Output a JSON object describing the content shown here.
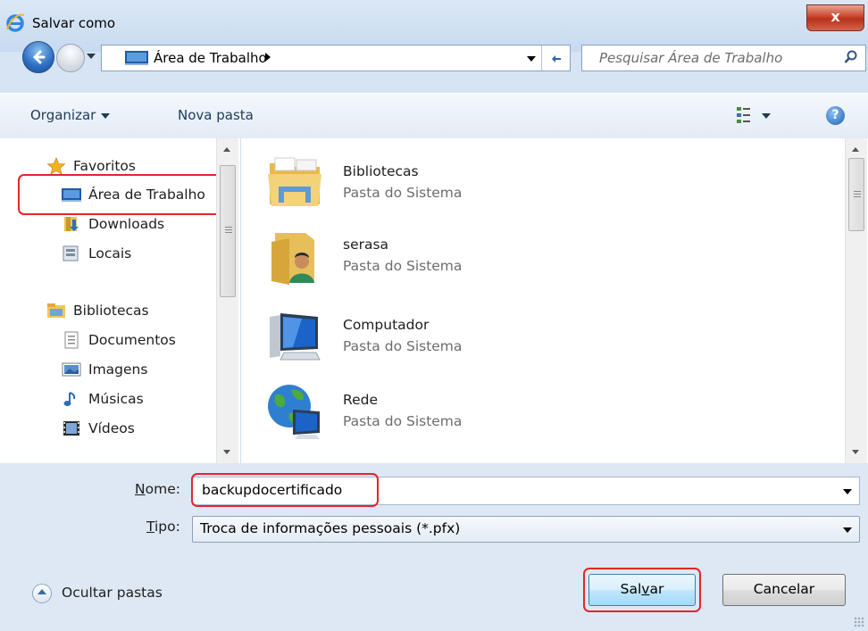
{
  "window": {
    "title": "Salvar como",
    "close_label": "x"
  },
  "address": {
    "location": "Área de Trabalho",
    "search_placeholder": "Pesquisar Área de Trabalho"
  },
  "toolbar": {
    "organize_label": "Organizar",
    "new_folder_label": "Nova pasta",
    "help_label": "?"
  },
  "navigation": {
    "favorites_header": "Favoritos",
    "favorites": [
      {
        "label": "Área de Trabalho",
        "icon": "desktop-icon"
      },
      {
        "label": "Downloads",
        "icon": "downloads-icon"
      },
      {
        "label": "Locais",
        "icon": "recent-places-icon"
      }
    ],
    "libraries_header": "Bibliotecas",
    "libraries": [
      {
        "label": "Documentos",
        "icon": "documents-icon"
      },
      {
        "label": "Imagens",
        "icon": "pictures-icon"
      },
      {
        "label": "Músicas",
        "icon": "music-icon"
      },
      {
        "label": "Vídeos",
        "icon": "videos-icon"
      }
    ],
    "selected": "Área de Trabalho"
  },
  "files": [
    {
      "name": "Bibliotecas",
      "type": "Pasta do Sistema",
      "icon": "libraries-folder-icon"
    },
    {
      "name": "serasa",
      "type": "Pasta do Sistema",
      "icon": "user-folder-icon"
    },
    {
      "name": "Computador",
      "type": "Pasta do Sistema",
      "icon": "computer-icon"
    },
    {
      "name": "Rede",
      "type": "Pasta do Sistema",
      "icon": "network-icon"
    }
  ],
  "form": {
    "name_label_u": "N",
    "name_label_rest": "ome:",
    "name_value": "backupdocertificado",
    "type_label_u": "T",
    "type_label_rest": "ipo:",
    "type_value": "Troca de informações pessoais (*.pfx)"
  },
  "footer": {
    "hide_folders_label": "Ocultar pastas",
    "save_label_pre": "Sal",
    "save_label_u": "v",
    "save_label_post": "ar",
    "cancel_label": "Cancelar"
  },
  "colors": {
    "highlight": "#e5242b",
    "accent": "#2c6cc0"
  }
}
